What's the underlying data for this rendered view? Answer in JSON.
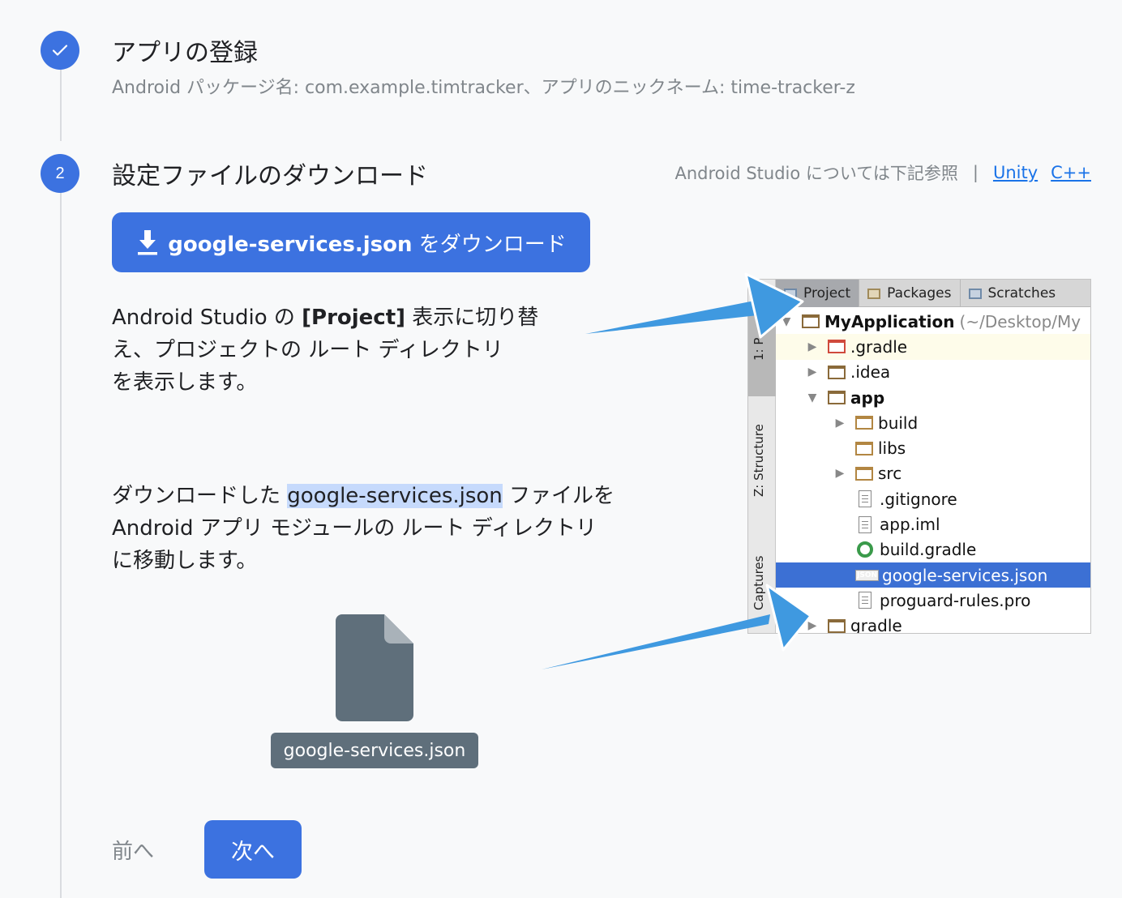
{
  "step1": {
    "number": "✓",
    "title": "アプリの登録",
    "subtitle": "Android パッケージ名: com.example.timtracker、アプリのニックネーム: time-tracker-z"
  },
  "step2": {
    "number": "2",
    "title": "設定ファイルのダウンロード",
    "helper_text": "Android Studio については下記参照",
    "separator": "|",
    "links": [
      "Unity",
      "C++"
    ],
    "download_button": {
      "filename": "google-services.json",
      "suffix": " をダウンロード"
    },
    "instruction1": {
      "prefix": "Android Studio の ",
      "bold": "[Project]",
      "rest_line1": " 表示に切り替",
      "line2": "え、プロジェクトの ルート ディレクトリ",
      "line3": "を表示します。"
    },
    "instruction2": {
      "prefix": "ダウンロードした ",
      "highlight": "google-services.json",
      "rest_line1": " ファイルを",
      "line2": "Android アプリ モジュールの ルート ディレクトリ",
      "line3": "に移動します。"
    },
    "file_label": "google-services.json",
    "nav": {
      "prev": "前へ",
      "next": "次へ"
    }
  },
  "ide": {
    "tabs": [
      "Project",
      "Packages",
      "Scratches"
    ],
    "side_labels": [
      "1: P",
      "Z: Structure",
      "Captures"
    ],
    "tree": [
      {
        "label": "MyApplication",
        "extra": "(~/Desktop/My",
        "level": 0,
        "expanded": true,
        "icon": "module"
      },
      {
        "label": ".gradle",
        "level": 1,
        "expanded": false,
        "icon": "folder-red"
      },
      {
        "label": ".idea",
        "level": 1,
        "expanded": false,
        "icon": "folder-plain"
      },
      {
        "label": "app",
        "level": 1,
        "expanded": true,
        "icon": "module"
      },
      {
        "label": "build",
        "level": 2,
        "expanded": false,
        "icon": "folder"
      },
      {
        "label": "libs",
        "level": 2,
        "icon": "folder"
      },
      {
        "label": "src",
        "level": 2,
        "expanded": false,
        "icon": "folder"
      },
      {
        "label": ".gitignore",
        "level": 2,
        "icon": "doc"
      },
      {
        "label": "app.iml",
        "level": 2,
        "icon": "doc"
      },
      {
        "label": "build.gradle",
        "level": 2,
        "icon": "gradle"
      },
      {
        "label": "google-services.json",
        "level": 2,
        "icon": "json",
        "json_tag": "JSON",
        "selected": true
      },
      {
        "label": "proguard-rules.pro",
        "level": 2,
        "icon": "doc"
      },
      {
        "label": "gradle",
        "level": 1,
        "expanded": false,
        "icon": "folder-plain"
      }
    ]
  }
}
